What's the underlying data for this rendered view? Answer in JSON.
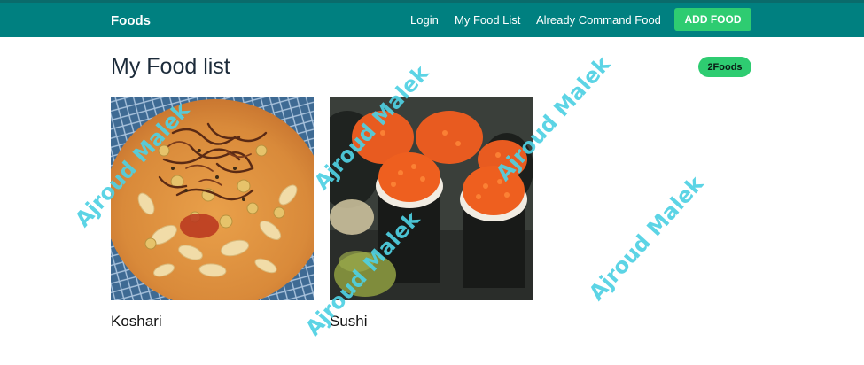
{
  "navbar": {
    "brand": "Foods",
    "links": [
      "Login",
      "My Food List",
      "Already Command Food"
    ],
    "add_button": "ADD FOOD",
    "color": "#008080"
  },
  "main": {
    "title": "My Food list",
    "badge": "2Foods",
    "foods": [
      {
        "name": "Koshari",
        "image": "koshari-photo"
      },
      {
        "name": "Sushi",
        "image": "sushi-photo"
      }
    ]
  },
  "watermark": {
    "text": "Ajroud Malek",
    "color": "#4fd1e3"
  },
  "colors": {
    "accent": "#2ecc71",
    "title": "#1c2b3a"
  }
}
